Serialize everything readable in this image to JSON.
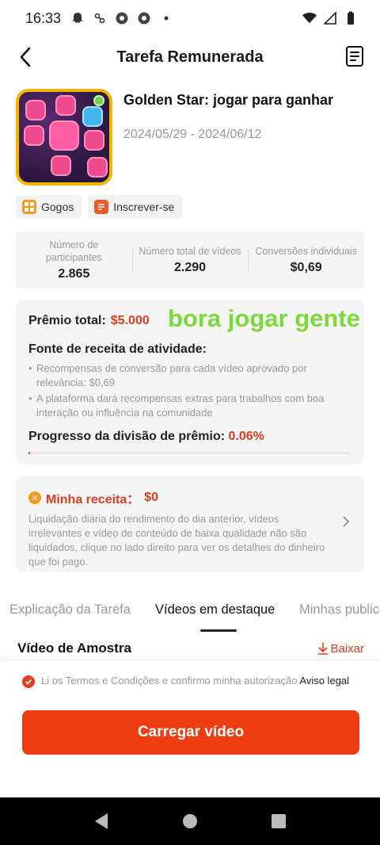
{
  "status_bar": {
    "time": "16:33"
  },
  "header": {
    "title": "Tarefa Remunerada"
  },
  "task": {
    "name": "Golden Star: jogar para ganhar",
    "dates": "2024/05/29 - 2024/06/12",
    "tags": [
      {
        "label": "Gogos",
        "icon": "grid-icon"
      },
      {
        "label": "Inscrever-se",
        "icon": "list-icon"
      }
    ]
  },
  "stats": [
    {
      "label": "Número de participantes",
      "value": "2.865"
    },
    {
      "label": "Número total de vídeos",
      "value": "2.290"
    },
    {
      "label": "Conversões individuais",
      "value": "$0,69"
    }
  ],
  "prize": {
    "total_label": "Prêmio total:",
    "total_value": "$5.000",
    "overlay_text": "bora jogar gente",
    "source_title": "Fonte de receita de atividade:",
    "source_items": [
      "Recompensas de conversão para cada vídeo aprovado por relevância: $0,69",
      "A plataforma dará recompensas extras para trabalhos com boa interação ou influência na comunidade"
    ],
    "progress_label": "Progresso da divisão de prêmio:",
    "progress_value": "0.06%",
    "progress_fraction": 0.0006
  },
  "income": {
    "title": "Minha receita：",
    "value": "$0",
    "description": "Liquidação diária do rendimento do dia anterior, vídeos irrelevantes e vídeo de conteúdo de baixa qualidade não são liquidados, clique no lado direito para ver os detalhes do dinheiro que foi pago."
  },
  "tabs": [
    {
      "label": "Explicação da Tarefa"
    },
    {
      "label": "Vídeos em destaque",
      "active": true
    },
    {
      "label": "Minhas publicações"
    }
  ],
  "sample": {
    "title": "Vídeo de Amostra",
    "download_label": "Baixar"
  },
  "footer": {
    "terms_text": "Li os Termos e Condições e confirmo minha autorização",
    "terms_link": "Aviso legal",
    "upload_label": "Carregar vídeo"
  },
  "colors": {
    "accent": "#ef3d12",
    "overlay_green": "#7bd93a"
  }
}
